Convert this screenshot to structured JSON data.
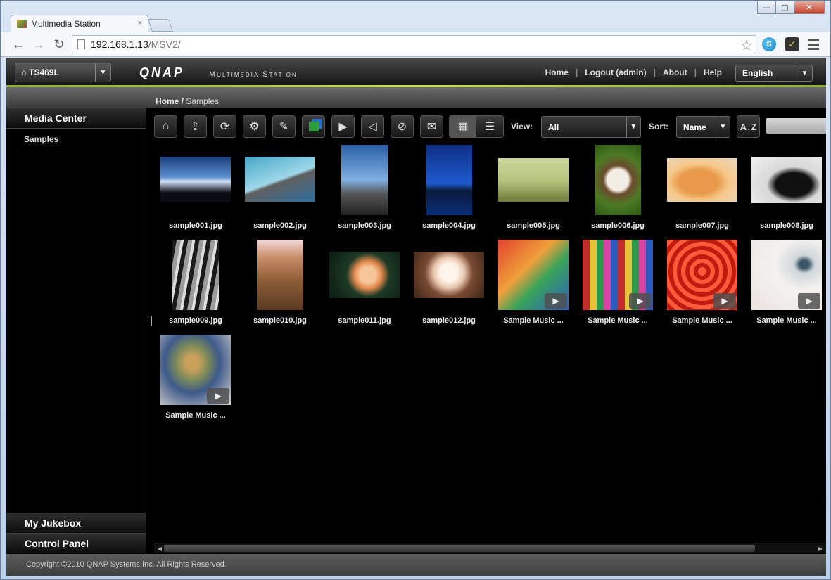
{
  "browser": {
    "tab_title": "Multimedia Station",
    "tab_close": "×",
    "url_host": "192.168.1.13",
    "url_path": "/MSV2/",
    "ext_skype": "S",
    "ext_check": "✓"
  },
  "window_controls": {
    "minimize": "—",
    "maximize": "▢",
    "close": "✕"
  },
  "header": {
    "server": "TS469L",
    "logo": "QNAP",
    "product": "Multimedia Station",
    "links": [
      "Home",
      "Logout (admin)",
      "About",
      "Help"
    ],
    "language": "English"
  },
  "breadcrumb": {
    "root": "Home",
    "separator": " / ",
    "current": "Samples"
  },
  "sidebar": {
    "header": "Media Center",
    "items": [
      "Samples"
    ],
    "bottom": [
      "My Jukebox",
      "Control Panel"
    ]
  },
  "toolbar": {
    "view_label": "View:",
    "view_value": "All",
    "sort_label": "Sort:",
    "sort_value": "Name",
    "az_label": "A↓Z"
  },
  "items": [
    {
      "name": "sample001.jpg",
      "type": "photo"
    },
    {
      "name": "sample002.jpg",
      "type": "photo"
    },
    {
      "name": "sample003.jpg",
      "type": "photo"
    },
    {
      "name": "sample004.jpg",
      "type": "photo"
    },
    {
      "name": "sample005.jpg",
      "type": "photo"
    },
    {
      "name": "sample006.jpg",
      "type": "photo"
    },
    {
      "name": "sample007.jpg",
      "type": "photo"
    },
    {
      "name": "sample008.jpg",
      "type": "photo"
    },
    {
      "name": "sample009.jpg",
      "type": "photo"
    },
    {
      "name": "sample010.jpg",
      "type": "photo"
    },
    {
      "name": "sample011.jpg",
      "type": "photo"
    },
    {
      "name": "sample012.jpg",
      "type": "photo"
    },
    {
      "name": "Sample Music ...",
      "type": "music"
    },
    {
      "name": "Sample Music ...",
      "type": "music"
    },
    {
      "name": "Sample Music ...",
      "type": "music"
    },
    {
      "name": "Sample Music ...",
      "type": "music"
    },
    {
      "name": "Sample Music ...",
      "type": "music"
    }
  ],
  "footer": {
    "copyright": "Copyright ©2010 QNAP Systems,Inc. All Rights Reserved."
  }
}
